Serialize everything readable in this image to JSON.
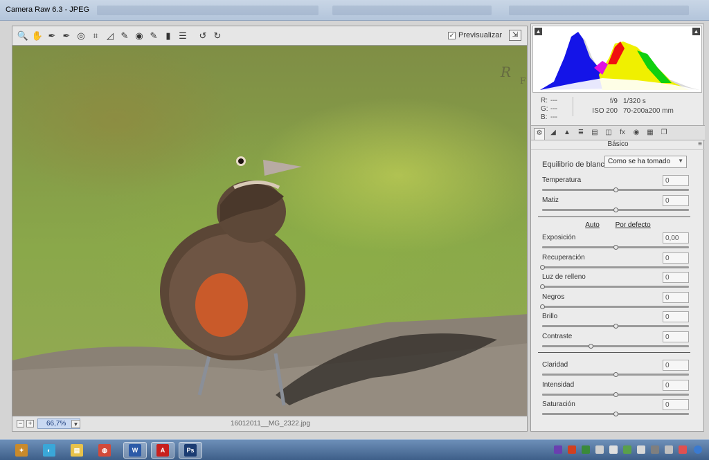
{
  "window": {
    "title": "Camera Raw 6.3 -  JPEG"
  },
  "toolbar": {
    "tools": [
      {
        "name": "zoom-tool-icon",
        "glyph": "🔍"
      },
      {
        "name": "hand-tool-icon",
        "glyph": "✋"
      },
      {
        "name": "white-balance-tool-icon",
        "glyph": "✒"
      },
      {
        "name": "color-sampler-tool-icon",
        "glyph": "✒"
      },
      {
        "name": "target-adjustment-tool-icon",
        "glyph": "◎"
      },
      {
        "name": "crop-tool-icon",
        "glyph": "⌗"
      },
      {
        "name": "straighten-tool-icon",
        "glyph": "◿"
      },
      {
        "name": "spot-removal-tool-icon",
        "glyph": "✎"
      },
      {
        "name": "red-eye-tool-icon",
        "glyph": "◉"
      },
      {
        "name": "adjustment-brush-icon",
        "glyph": "✎"
      },
      {
        "name": "graduated-filter-icon",
        "glyph": "▮"
      },
      {
        "name": "preferences-icon",
        "glyph": "☰"
      },
      {
        "name": "rotate-left-icon",
        "glyph": "↺"
      },
      {
        "name": "rotate-right-icon",
        "glyph": "↻"
      }
    ],
    "preview_label": "Previsualizar",
    "preview_checked": true
  },
  "status": {
    "zoom": "66,7%",
    "filename": "16012011__MG_2322.jpg"
  },
  "histogram": {
    "rgb": [
      {
        "label": "R:",
        "value": "---"
      },
      {
        "label": "G:",
        "value": "---"
      },
      {
        "label": "B:",
        "value": "---"
      }
    ],
    "aperture": "f/9",
    "shutter": "1/320 s",
    "iso": "ISO 200",
    "lens": "70-200a200 mm"
  },
  "panel": {
    "title": "Básico",
    "tabs": [
      "⚙",
      "◢",
      "▲",
      "≣",
      "▤",
      "◫",
      "fx",
      "◉",
      "▦",
      "❐"
    ],
    "white_balance_label": "Equilibrio de blancos:",
    "white_balance_value": "Como se ha tomado",
    "auto_label": "Auto",
    "default_label": "Por defecto",
    "sliders": [
      {
        "label": "Temperatura",
        "value": "0",
        "pos": 0.5
      },
      {
        "label": "Matiz",
        "value": "0",
        "pos": 0.5
      },
      {
        "label": "Exposición",
        "value": "0,00",
        "pos": 0.5
      },
      {
        "label": "Recuperación",
        "value": "0",
        "pos": 0.0
      },
      {
        "label": "Luz de relleno",
        "value": "0",
        "pos": 0.0
      },
      {
        "label": "Negros",
        "value": "0",
        "pos": 0.0
      },
      {
        "label": "Brillo",
        "value": "0",
        "pos": 0.5
      },
      {
        "label": "Contraste",
        "value": "0",
        "pos": 0.33
      },
      {
        "label": "Claridad",
        "value": "0",
        "pos": 0.5
      },
      {
        "label": "Intensidad",
        "value": "0",
        "pos": 0.5
      },
      {
        "label": "Saturación",
        "value": "0",
        "pos": 0.5
      }
    ]
  },
  "taskbar": {
    "items": [
      {
        "name": "taskbar-app-1",
        "glyph": "✦",
        "color": "#c98a2b"
      },
      {
        "name": "taskbar-app-2",
        "glyph": "◐",
        "color": "#3aa7d8"
      },
      {
        "name": "taskbar-explorer",
        "glyph": "▤",
        "color": "#e8c24a"
      },
      {
        "name": "taskbar-app-4",
        "glyph": "◍",
        "color": "#d24a3a"
      },
      {
        "name": "taskbar-word",
        "glyph": "W",
        "color": "#2b5aa8"
      },
      {
        "name": "taskbar-acrobat",
        "glyph": "A",
        "color": "#c8201e"
      },
      {
        "name": "taskbar-photoshop",
        "glyph": "Ps",
        "color": "#1b3c72"
      }
    ]
  }
}
